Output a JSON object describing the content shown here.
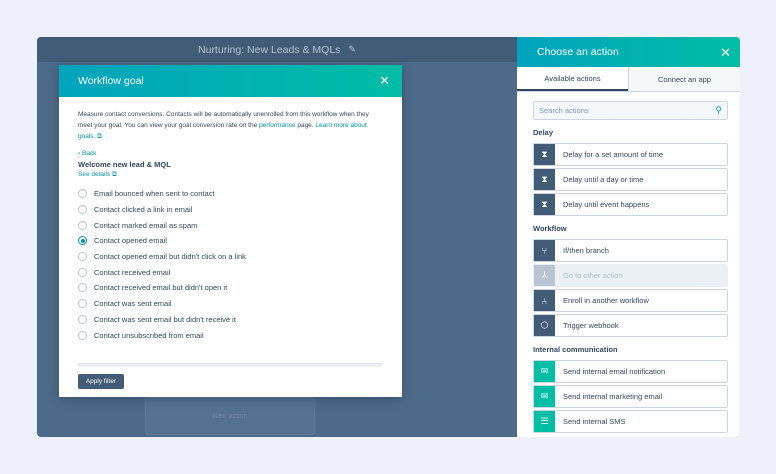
{
  "workflow": {
    "title": "Nurturing: New Leads & MQLs",
    "canvas_node_label": "New action"
  },
  "panel": {
    "title": "Choose an action",
    "tabs": [
      {
        "label": "Available actions"
      },
      {
        "label": "Connect an app"
      }
    ],
    "search_placeholder": "Search actions",
    "sections": [
      {
        "label": "Delay",
        "items": [
          {
            "label": "Delay for a set amount of time",
            "icon": "hourglass-icon"
          },
          {
            "label": "Delay until a day or time",
            "icon": "hourglass-icon"
          },
          {
            "label": "Delay until event happens",
            "icon": "hourglass-icon"
          }
        ]
      },
      {
        "label": "Workflow",
        "items": [
          {
            "label": "If/then branch",
            "icon": "branch-icon"
          },
          {
            "label": "Go to other action",
            "icon": "goto-icon",
            "disabled": true
          },
          {
            "label": "Enroll in another workflow",
            "icon": "workflow-icon"
          },
          {
            "label": "Trigger webhook",
            "icon": "webhook-icon"
          }
        ]
      },
      {
        "label": "Internal communication",
        "items": [
          {
            "label": "Send internal email notification",
            "icon": "email-icon"
          },
          {
            "label": "Send internal marketing email",
            "icon": "email-icon"
          },
          {
            "label": "Send internal SMS",
            "icon": "sms-icon"
          }
        ]
      }
    ]
  },
  "modal": {
    "title": "Workflow goal",
    "description_pre": "Measure contact conversions. Contacts will be automatically unenrolled from this workflow when they meet your goal. You can view your goal conversion rate on the ",
    "description_link1": "performance",
    "description_mid": " page. ",
    "description_link2": "Learn more about goals.",
    "back_label": "Back",
    "goal_name": "Welcome new lead & MQL",
    "see_details": "See details",
    "options": [
      {
        "label": "Email bounced when sent to contact",
        "checked": false
      },
      {
        "label": "Contact clicked a link in email",
        "checked": false
      },
      {
        "label": "Contact marked email as spam",
        "checked": false
      },
      {
        "label": "Contact opened email",
        "checked": true
      },
      {
        "label": "Contact opened email but didn't click on a link",
        "checked": false
      },
      {
        "label": "Contact received email",
        "checked": false
      },
      {
        "label": "Contact received email but didn't open it",
        "checked": false
      },
      {
        "label": "Contact was sent email",
        "checked": false
      },
      {
        "label": "Contact was sent email but didn't receive it",
        "checked": false
      },
      {
        "label": "Contact unsubscribed from email",
        "checked": false
      }
    ],
    "apply_label": "Apply filter"
  }
}
